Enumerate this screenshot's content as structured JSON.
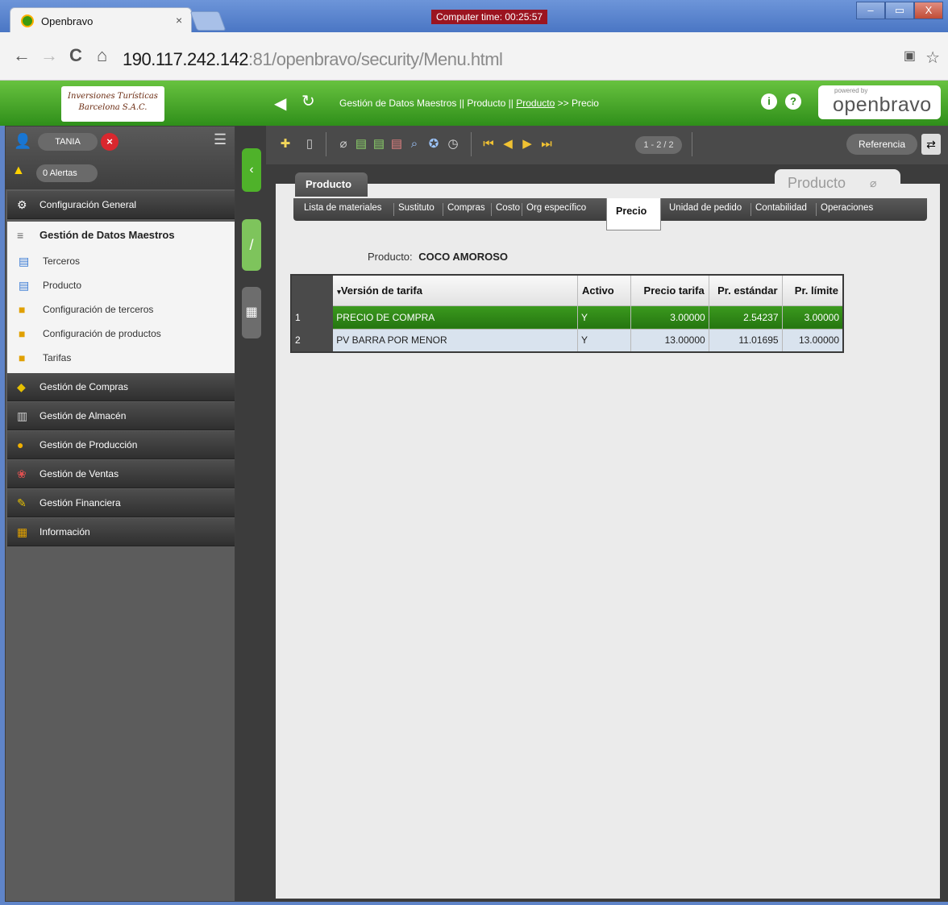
{
  "browser": {
    "tab_title": "Openbravo",
    "tab_close": "×",
    "clock": "Computer time: 00:25:57",
    "url_host": "190.117.242.142",
    "url_rest": ":81/openbravo/security/Menu.html",
    "window_buttons": [
      "–",
      "▭",
      "X"
    ]
  },
  "header": {
    "company_line1": "Inversiones Turísticas",
    "company_line2": "Barcelona S.A.C.",
    "crumb_1": "Gestión de Datos Maestros",
    "crumb_2": "Producto",
    "crumb_3": "Producto",
    "crumb_4": "Precio",
    "powered_by": "powered by",
    "brand": "openbravo"
  },
  "user": {
    "name": "TANIA",
    "alerts": "0 Alertas"
  },
  "sidebar": {
    "config_general": "Configuración General",
    "section_title": "Gestión de Datos Maestros",
    "sub_items": [
      "Terceros",
      "Producto",
      "Configuración de terceros",
      "Configuración de productos",
      "Tarifas"
    ],
    "menu_items": [
      "Gestión de Compras",
      "Gestión de Almacén",
      "Gestión de Producción",
      "Gestión de Ventas",
      "Gestión Financiera",
      "Información"
    ]
  },
  "toolbar": {
    "pager": "1 - 2 / 2",
    "reference": "Referencia"
  },
  "tabs": {
    "main": "Producto",
    "form": "Producto",
    "subtabs": [
      "Lista de materiales",
      "Sustituto",
      "Compras",
      "Costo",
      "Org específico"
    ],
    "active": "Precio",
    "subtabs_right": [
      "Unidad de pedido",
      "Contabilidad",
      "Operaciones"
    ]
  },
  "product": {
    "label": "Producto:",
    "value": "COCO AMOROSO"
  },
  "table": {
    "columns": [
      "Versión de tarifa",
      "Activo",
      "Precio tarifa",
      "Pr. estándar",
      "Pr. límite"
    ],
    "rows": [
      {
        "n": "1",
        "version": "PRECIO DE COMPRA",
        "activo": "Y",
        "tarifa": "3.00000",
        "estandar": "2.54237",
        "limite": "3.00000"
      },
      {
        "n": "2",
        "version": "PV BARRA POR MENOR",
        "activo": "Y",
        "tarifa": "13.00000",
        "estandar": "11.01695",
        "limite": "13.00000"
      }
    ]
  }
}
